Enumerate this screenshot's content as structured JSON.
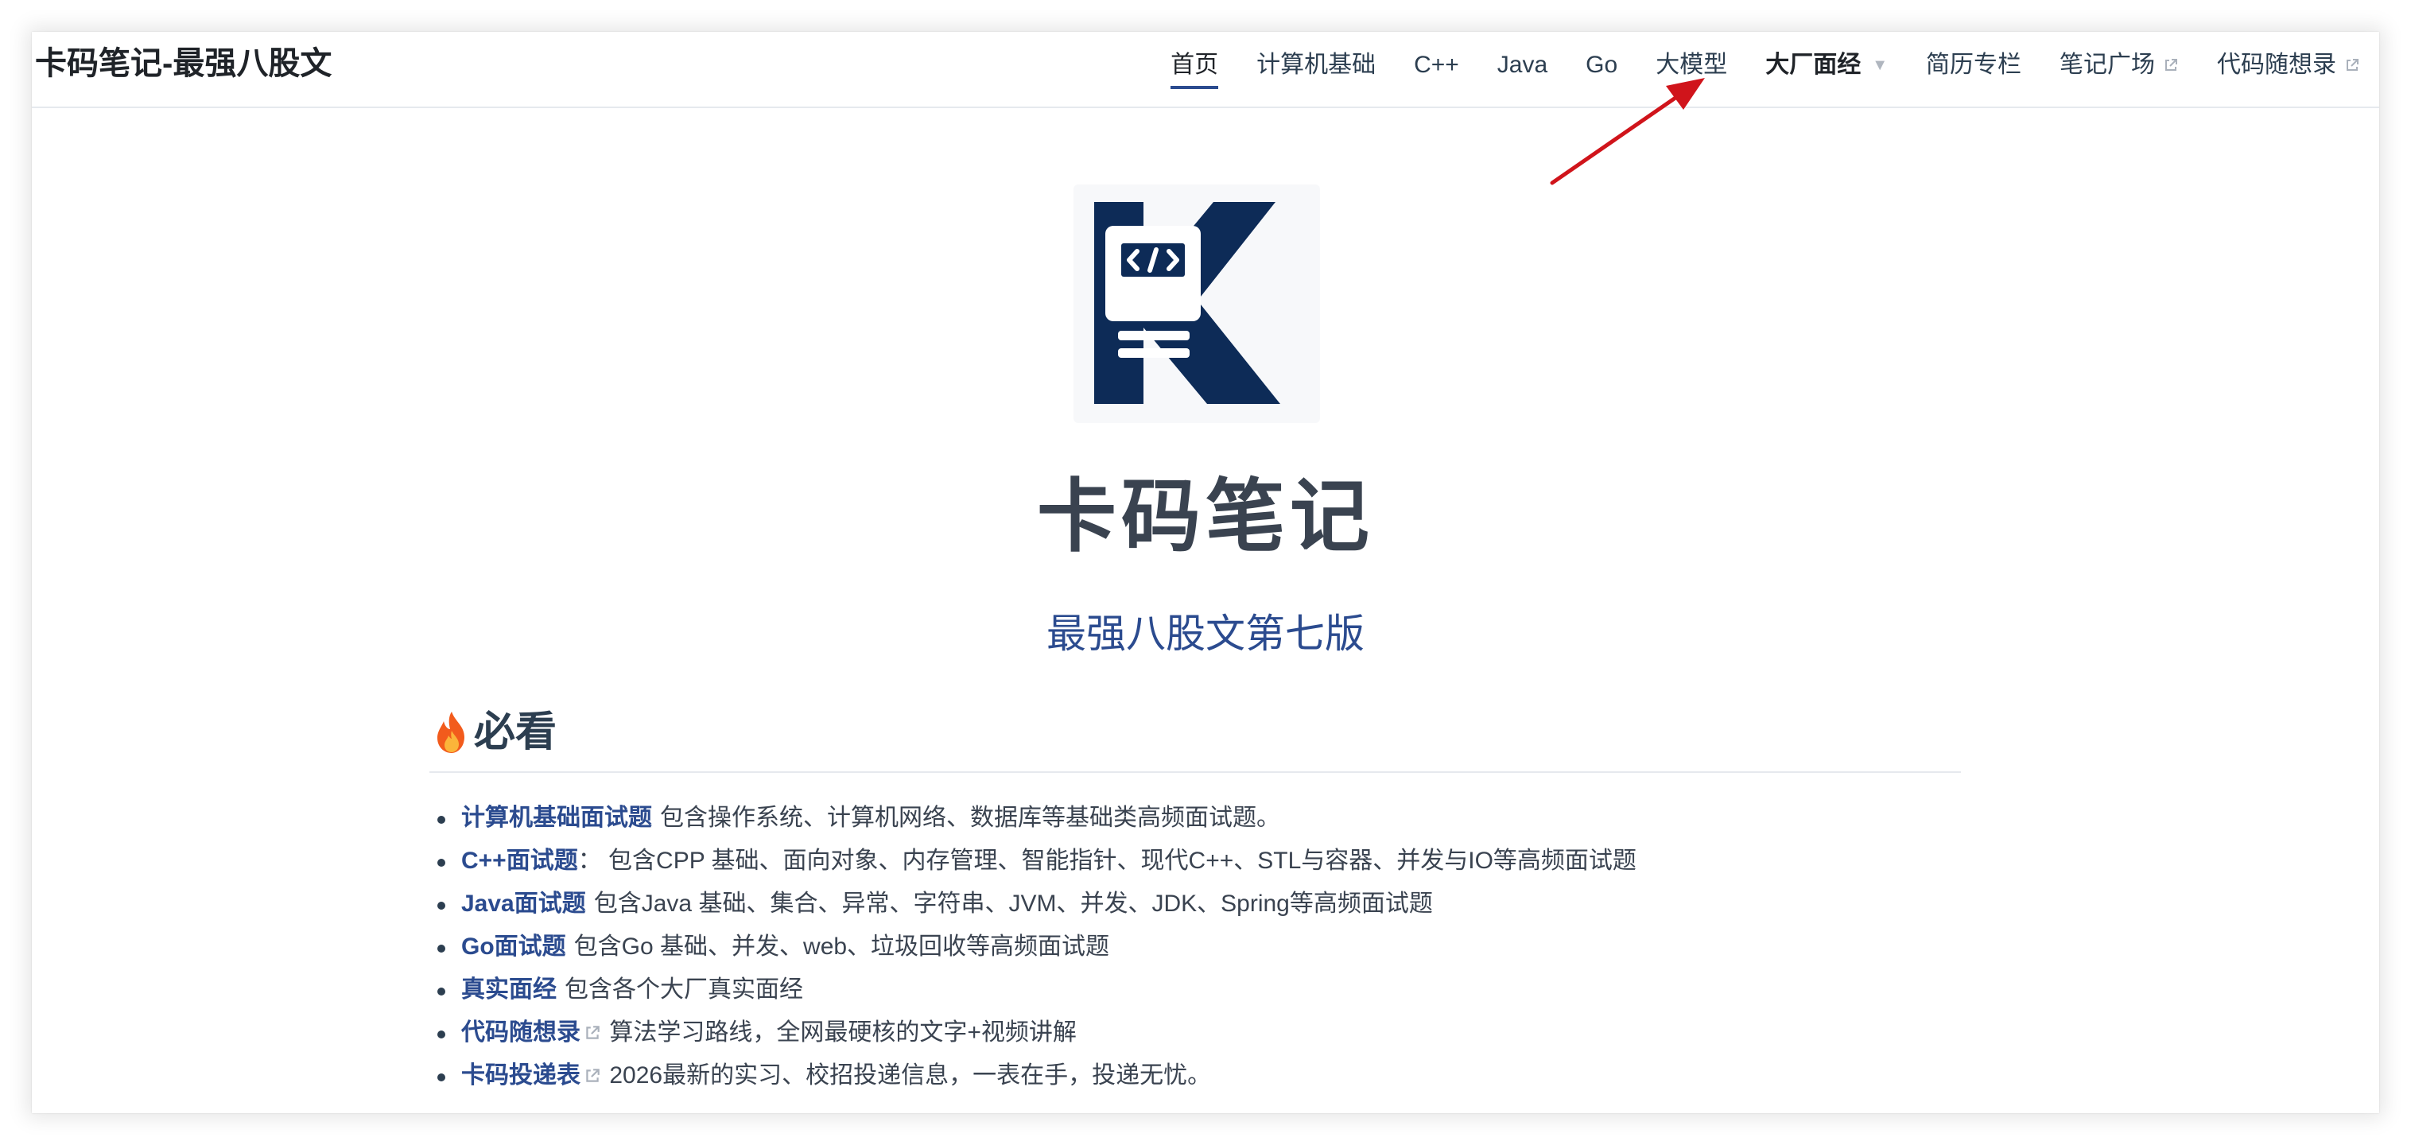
{
  "site": {
    "title": "卡码笔记-最强八股文"
  },
  "nav": {
    "items": [
      {
        "label": "首页"
      },
      {
        "label": "计算机基础"
      },
      {
        "label": "C++"
      },
      {
        "label": "Java"
      },
      {
        "label": "Go"
      },
      {
        "label": "大模型"
      },
      {
        "label": "大厂面经"
      },
      {
        "label": "简历专栏"
      },
      {
        "label": "笔记广场"
      },
      {
        "label": "代码随想录"
      }
    ],
    "active_index": 0,
    "dropdown_item": "大厂面经",
    "external_items": [
      "笔记广场",
      "代码随想录"
    ]
  },
  "hero": {
    "logo_icon": "kama-k-code-logo-icon",
    "name": "卡码笔记",
    "tagline": "最强八股文第七版"
  },
  "section": {
    "heading": "必看",
    "heading_icon": "fire-emoji-icon",
    "items": [
      {
        "link": "计算机基础面试题",
        "desc": "包含操作系统、计算机网络、数据库等基础类高频面试题。"
      },
      {
        "link": "C++面试题",
        "desc": "： 包含CPP 基础、面向对象、内存管理、智能指针、现代C++、STL与容器、并发与IO等高频面试题"
      },
      {
        "link": "Java面试题",
        "desc": "包含Java 基础、集合、异常、字符串、JVM、并发、JDK、Spring等高频面试题"
      },
      {
        "link": "Go面试题",
        "desc": "包含Go 基础、并发、web、垃圾回收等高频面试题"
      },
      {
        "link": "真实面经",
        "desc": "包含各个大厂真实面经"
      },
      {
        "link": "代码随想录",
        "desc": "算法学习路线，全网最硬核的文字+视频讲解"
      },
      {
        "link": "卡码投递表",
        "desc": "2026最新的实习、校招投递信息，一表在手，投递无忧。"
      }
    ]
  },
  "colors": {
    "accent": "#2b4b8f",
    "logo_navy": "#0d2b57",
    "text": "#2c3e50",
    "annotation_arrow": "#d0141b"
  }
}
